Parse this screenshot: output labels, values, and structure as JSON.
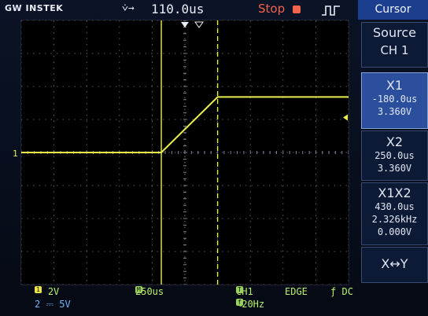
{
  "topbar": {
    "brand": "GW INSTEK",
    "trigger_position_icon": "⩒→",
    "horizontal_position": "110.0us",
    "run_state": "Stop",
    "trigger_icon": "edge-trigger-icon"
  },
  "menu": {
    "title": "Cursor",
    "source": {
      "label": "Source",
      "value": "CH 1"
    },
    "x1": {
      "label": "X1",
      "time": "-180.0us",
      "volts": "3.360V"
    },
    "x2": {
      "label": "X2",
      "time": "250.0us",
      "volts": "3.360V"
    },
    "x1x2": {
      "label": "X1X2",
      "delta_t": "430.0us",
      "freq": "2.326kHz",
      "delta_v": "0.000V"
    },
    "swap": {
      "label": "X↔Y"
    }
  },
  "status": {
    "ch1_scale": "2V",
    "ch2_scale": "5V",
    "timebase": "250us",
    "trigger_source": "CH1",
    "trigger_type": "EDGE",
    "trigger_coupling": "DC",
    "filter": "<20Hz",
    "ch1_marker": "1",
    "ch1_label": "1",
    "ch2_label": "2",
    "timebase_icon": "M",
    "trig_icon": "T",
    "filter_icon": "f"
  },
  "colors": {
    "trace": "#e9ee4c",
    "graticule": "#7d8796",
    "cursor": "#e9ee4c",
    "accent": "#1b3f8e",
    "stop": "#f0644e",
    "status_text": "#b6f16c"
  },
  "chart_data": {
    "type": "line",
    "x": [
      -1250,
      -180,
      250,
      1250
    ],
    "y": [
      0.0,
      0.0,
      3.36,
      3.36
    ],
    "xlim": [
      -1250,
      1250
    ],
    "ylim": [
      -8,
      8
    ],
    "grid": true,
    "cursors_x": [
      -180,
      250
    ]
  }
}
